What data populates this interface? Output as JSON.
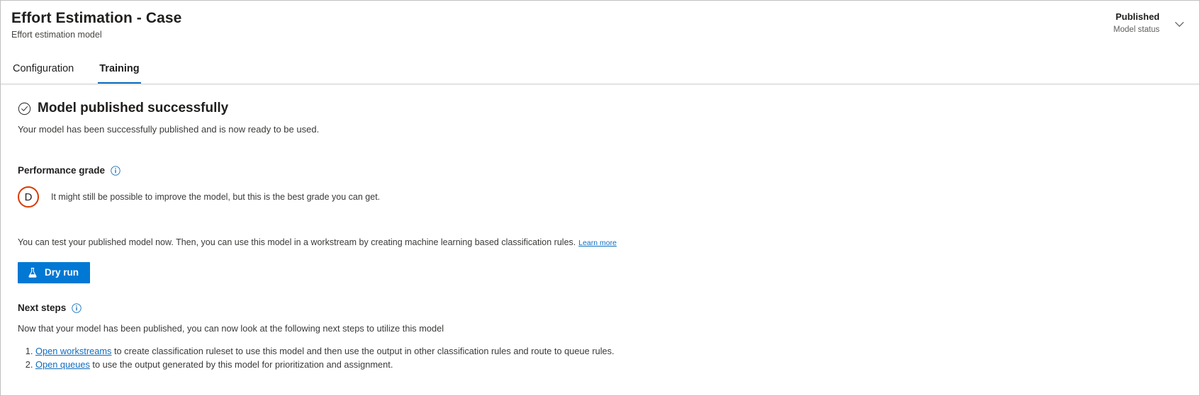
{
  "header": {
    "title": "Effort Estimation - Case",
    "subtitle": "Effort estimation model",
    "status_value": "Published",
    "status_label": "Model status",
    "chevron_icon": "chevron-down-icon"
  },
  "tabs": [
    {
      "label": "Configuration",
      "active": false
    },
    {
      "label": "Training",
      "active": true
    }
  ],
  "main": {
    "success_icon": "check-circle-icon",
    "success_title": "Model published successfully",
    "success_desc": "Your model has been successfully published and is now ready to be used.",
    "performance": {
      "heading": "Performance grade",
      "info_icon": "info-icon",
      "grade": "D",
      "grade_color": "#d83b01",
      "grade_desc": "It might still be possible to improve the model, but this is the best grade you can get."
    },
    "test_line": {
      "text": "You can test your published model now. Then, you can use this model in a workstream by creating machine learning based classification rules.",
      "link_label": "Learn more"
    },
    "dry_run": {
      "label": "Dry run",
      "icon": "flask-icon",
      "color": "#0078d4"
    },
    "next_steps": {
      "heading": "Next steps",
      "info_icon": "info-icon",
      "description": "Now that your model has been published, you can now look at the following next steps to utilize this model",
      "items": [
        {
          "link": "Open workstreams",
          "text": " to create classification ruleset to use this model and then use the output in other classification rules and route to queue rules."
        },
        {
          "link": "Open queues",
          "text": " to use the output generated by this model for prioritization and assignment."
        }
      ]
    }
  }
}
